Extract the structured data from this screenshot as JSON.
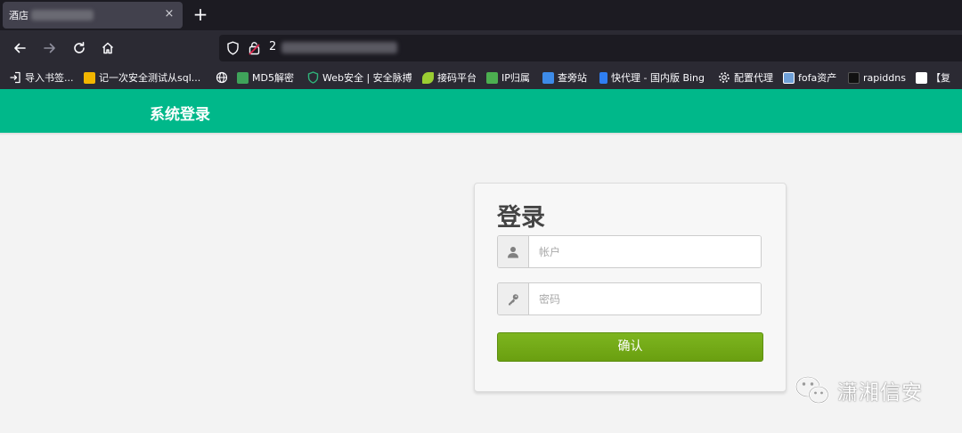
{
  "browser": {
    "tab": {
      "title": "酒店",
      "close": "×"
    },
    "new_tab": "+",
    "url": {
      "visible_text": "2"
    },
    "bookmarks": [
      {
        "label": "导入书签...",
        "icon": "import-icon",
        "color": "#fbfbfe"
      },
      {
        "label": "记一次安全测试从sql...",
        "icon": "site-favicon",
        "color": "#f2b600"
      },
      {
        "label": "",
        "icon": "globe-icon",
        "color": "#fbfbfe"
      },
      {
        "label": "MD5解密",
        "icon": "md5-favicon",
        "color": "#3fa35a"
      },
      {
        "label": "Web安全 | 安全脉搏",
        "icon": "shield-favicon",
        "color": "#2fb37a"
      },
      {
        "label": "接码平台",
        "icon": "leaf-favicon",
        "color": "#9acd32"
      },
      {
        "label": "IP归属",
        "icon": "ip-favicon",
        "color": "#4caf50"
      },
      {
        "label": "查旁站",
        "icon": "monitor-favicon",
        "color": "#3d8be8"
      },
      {
        "label": "快代理 - 国内版 Bing",
        "icon": "bing-favicon",
        "color": "#2f7ff2"
      },
      {
        "label": "配置代理",
        "icon": "gear-icon",
        "color": "#fbfbfe"
      },
      {
        "label": "fofa资产",
        "icon": "fofa-favicon",
        "color": "#6fa0d8"
      },
      {
        "label": "rapiddns",
        "icon": "rapiddns-favicon",
        "color": "#111111"
      },
      {
        "label": "【复",
        "icon": "site-favicon-2",
        "color": "#ffffff"
      }
    ]
  },
  "app": {
    "header_title": "系统登录"
  },
  "login": {
    "heading": "登录",
    "username_placeholder": "帐户",
    "password_placeholder": "密码",
    "submit_label": "确认",
    "username_icon": "user-icon",
    "password_icon": "key-icon"
  },
  "watermark": {
    "text": "潇湘信安",
    "icon": "wechat-icon"
  },
  "colors": {
    "header_green": "#00b88a",
    "button_green": "#72a815",
    "page_bg": "#f3f3f3"
  }
}
